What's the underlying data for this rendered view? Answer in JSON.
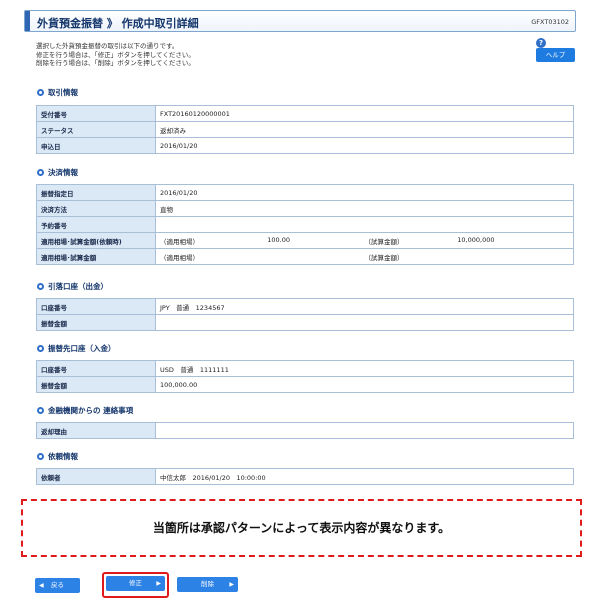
{
  "header": {
    "title": "外貨預金振替 》 作成中取引詳細",
    "screen_id": "GFXT03102"
  },
  "intro": {
    "lines": [
      "選択した外貨預金振替の取引は以下の通りです。",
      "修正を行う場合は、「修正」ボタンを押してください。",
      "削除を行う場合は、「削除」ボタンを押してください。"
    ]
  },
  "help": {
    "icon": "?",
    "label": "ヘルプ"
  },
  "sections": {
    "transaction": {
      "heading": "取引情報",
      "rows": [
        {
          "label": "受付番号",
          "value": "FXT20160120000001"
        },
        {
          "label": "ステータス",
          "value": "返却済み"
        },
        {
          "label": "申込日",
          "value": "2016/01/20"
        }
      ]
    },
    "settlement": {
      "heading": "決済情報",
      "rows": [
        {
          "label": "振替指定日",
          "value": "2016/01/20"
        },
        {
          "label": "決済方法",
          "value": "直物"
        },
        {
          "label": "予約番号",
          "value": ""
        }
      ],
      "rate_row": {
        "label": "適用相場･試算金額(依頼時)",
        "rate_label": "（適用相場）",
        "rate_value": "100.00",
        "amount_label": "（試算金額）",
        "amount_value": "10,000,000"
      },
      "rate_row2": {
        "label": "適用相場･試算金額",
        "rate_label": "（適用相場）",
        "amount_label": "（試算金額）"
      }
    },
    "debit": {
      "heading": "引落口座（出金）",
      "rows": [
        {
          "label": "口座番号",
          "value": "JPY　普通　1234567"
        },
        {
          "label": "振替金額",
          "value": ""
        }
      ]
    },
    "credit": {
      "heading": "振替先口座（入金）",
      "rows": [
        {
          "label": "口座番号",
          "value": "USD　普通　1111111"
        },
        {
          "label": "振替金額",
          "value": "100,000.00"
        }
      ]
    },
    "bank_notes": {
      "heading": "金融機関からの 連絡事項",
      "rows": [
        {
          "label": "返却理由",
          "value": ""
        }
      ]
    },
    "requester": {
      "heading": "依頼情報",
      "rows": [
        {
          "label": "依頼者",
          "value": "中信太郎　2016/01/20　10:00:00"
        }
      ]
    }
  },
  "notice": "当箇所は承認パターンによって表示内容が異なります。",
  "buttons": {
    "back": "戻る",
    "edit": "修正",
    "delete": "削除"
  },
  "colors": {
    "accent": "#2f67b4",
    "button": "#2d82e6",
    "highlight": "#e01a1a",
    "header_cell": "#dbe8f6"
  }
}
